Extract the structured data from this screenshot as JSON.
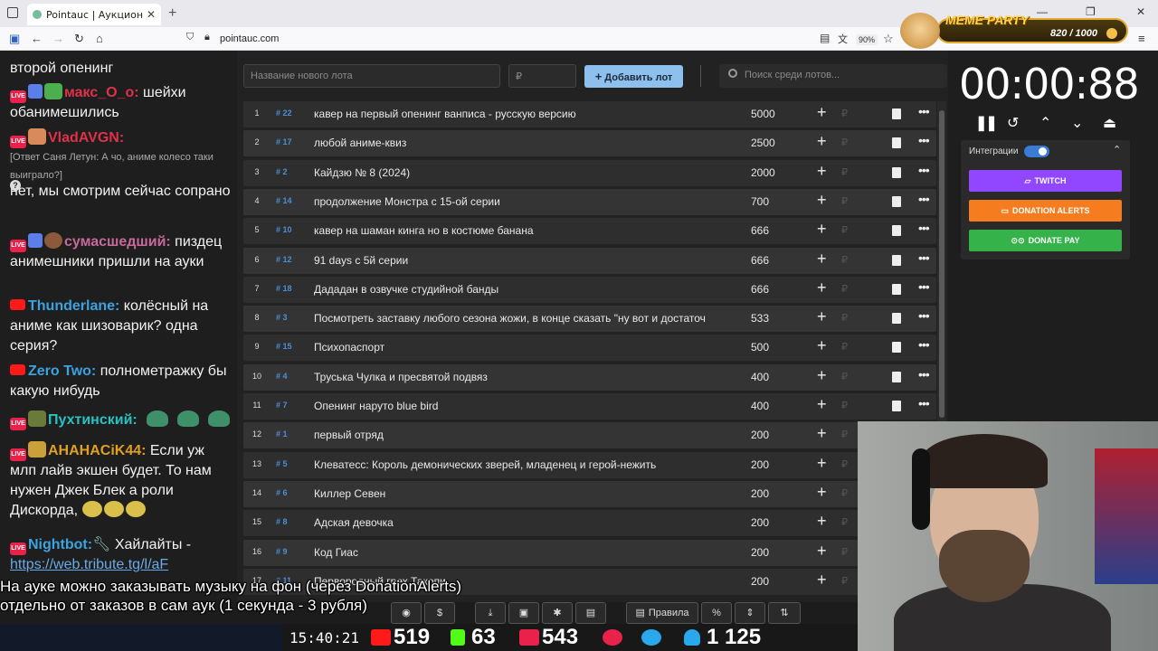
{
  "browser": {
    "tab_title": "Pointauc | Аукцион для стримера",
    "url": "pointauc.com",
    "zoom": "90%"
  },
  "meme_party": {
    "name": "MEME PARTY",
    "points": "820 / 1000"
  },
  "chat": {
    "messages": [
      {
        "text": "второй опенинг"
      },
      {
        "user": "макс_О_о:",
        "user_color": "#e0314a",
        "text": " шейхи обанимешились"
      },
      {
        "user": "VladAVGN:",
        "user_color": "#e0314a",
        "reply": "[Ответ Саня Летун: А чо, аниме колесо таки выиграло?]",
        "text": "нет, мы смотрим сейчас сопрано"
      },
      {
        "user": "сумасшедший:",
        "user_color": "#c56a9a",
        "text": " пиздец анимешники пришли на ауки"
      },
      {
        "user": "Thunderlane:",
        "user_color": "#3aa3e0",
        "text": " колёсный на аниме как шизоварик? одна серия?"
      },
      {
        "user": "Zero Two:",
        "user_color": "#3aa3e0",
        "text": " полнометражку бы какую нибудь"
      },
      {
        "user": "Пухтинский:",
        "user_color": "#27c2c2",
        "text": ""
      },
      {
        "user": "AHAHACiK44:",
        "user_color": "#e0a020",
        "text": " Если уж млп лайв экшен будет. То нам нужен Джек Блек а роли Дискорда,"
      },
      {
        "user": "Nightbot:",
        "user_color": "#3aa3e0",
        "text": " Хайлайты -",
        "link": "https://web.tribute.tg/l/aF"
      }
    ]
  },
  "auction": {
    "new_lot_placeholder": "Название нового лота",
    "amount_placeholder": "₽",
    "add_button": "Добавить лот",
    "search_placeholder": "Поиск среди лотов...",
    "currency": "₽",
    "lots": [
      {
        "n": "1",
        "id": "# 22",
        "name": "кавер на первый опенинг ванписа - русскую версию",
        "amount": "5000"
      },
      {
        "n": "2",
        "id": "# 17",
        "name": "любой аниме-квиз",
        "amount": "2500"
      },
      {
        "n": "3",
        "id": "# 2",
        "name": "Кайдзю № 8 (2024)",
        "amount": "2000"
      },
      {
        "n": "4",
        "id": "# 14",
        "name": "продолжение Монстра с 15-ой серии",
        "amount": "700"
      },
      {
        "n": "5",
        "id": "# 10",
        "name": "кавер на шаман кинга но в костюме банана",
        "amount": "666"
      },
      {
        "n": "6",
        "id": "# 12",
        "name": "91 days с 5й серии",
        "amount": "666"
      },
      {
        "n": "7",
        "id": "# 18",
        "name": "Дададан в озвучке студийной банды",
        "amount": "666"
      },
      {
        "n": "8",
        "id": "# 3",
        "name": "Посмотреть заставку любого сезона жожи, в конце сказать \"ну вот и достаточ",
        "amount": "533"
      },
      {
        "n": "9",
        "id": "# 15",
        "name": "Психопаспорт",
        "amount": "500"
      },
      {
        "n": "10",
        "id": "# 4",
        "name": "Труська Чулка и пресвятой подвяз",
        "amount": "400"
      },
      {
        "n": "11",
        "id": "# 7",
        "name": "Опенинг наруто blue bird",
        "amount": "400"
      },
      {
        "n": "12",
        "id": "# 1",
        "name": "первый отряд",
        "amount": "200"
      },
      {
        "n": "13",
        "id": "# 5",
        "name": "Клеватесс: Король демонических зверей, младенец и герой-нежить",
        "amount": "200"
      },
      {
        "n": "14",
        "id": "# 6",
        "name": "Киллер Севен",
        "amount": "200"
      },
      {
        "n": "15",
        "id": "# 8",
        "name": "Адская девочка",
        "amount": "200"
      },
      {
        "n": "16",
        "id": "# 9",
        "name": "Код Гиас",
        "amount": "200"
      },
      {
        "n": "17",
        "id": "# 11",
        "name": "Первородный грех Такопи",
        "amount": "200"
      }
    ]
  },
  "timer": {
    "value": "00:00:88"
  },
  "integrations": {
    "label": "Интеграции",
    "twitch": "TWITCH",
    "donation_alerts": "DONATION ALERTS",
    "donate_pay": "DONATE PAY"
  },
  "overlay": {
    "line1": "На ауке можно заказывать музыку на фон (через DonationAlerts)",
    "line2": "отдельно от заказов в сам аук (1 секунда - 3 рубля)"
  },
  "toolbar": {
    "rules": "Правила",
    "percent": "%",
    "dollar": "$"
  },
  "stats": {
    "clock": "15:40:21",
    "youtube_viewers": "519",
    "kick_viewers": "63",
    "live_viewers": "543",
    "telegram_users": "1 125"
  },
  "colors": {
    "twitch": "#9146ff",
    "donation_alerts": "#f57d1f",
    "donate_pay": "#36b24a",
    "add_button": "#8ec0ee",
    "lot_id": "#4b8fd8"
  }
}
